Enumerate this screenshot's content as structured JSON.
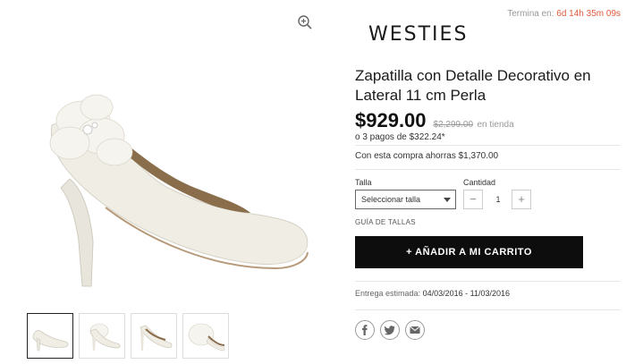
{
  "timer": {
    "label": "Termina en:",
    "time": "6d 14h 35m 09s"
  },
  "brand": "WESTIES",
  "product": {
    "title": "Zapatilla con Detalle Decorativo en Lateral 11 cm Perla",
    "price": "$929.00",
    "old_price": "$2,299.00",
    "old_price_suffix": "en tienda",
    "installments": "o 3 pagos de $322.24*",
    "savings": "Con esta compra ahorras $1,370.00"
  },
  "size": {
    "label": "Talla",
    "placeholder": "Seleccionar talla"
  },
  "quantity": {
    "label": "Cantidad",
    "value": "1",
    "minus": "−",
    "plus": "+"
  },
  "size_guide": "GUÍA DE TALLAS",
  "cart_button": "+ AÑADIR A MI CARRITO",
  "delivery": {
    "label": "Entrega estimada:",
    "dates": "04/03/2016 - 11/03/2016"
  },
  "social": [
    "facebook-icon",
    "twitter-icon",
    "email-icon"
  ],
  "colors": {
    "accent": "#0d0d0d",
    "timer": "#e05a3a",
    "shoe": "#efede4"
  }
}
